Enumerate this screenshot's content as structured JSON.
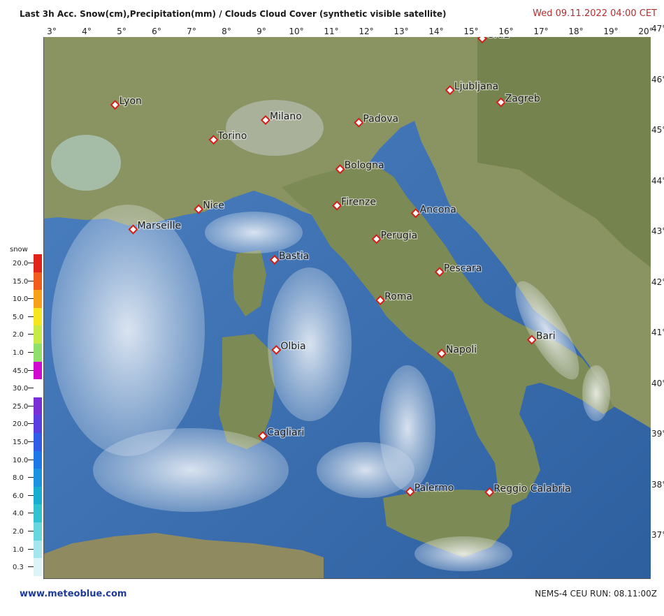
{
  "header": {
    "title": "Last 3h Acc. Snow(cm),Precipitation(mm) / Clouds Cloud Cover (synthetic visible satellite)",
    "datetime": "Wed 09.11.2022  04:00 CET"
  },
  "axes": {
    "longitude_ticks": [
      "3°",
      "4°",
      "5°",
      "6°",
      "7°",
      "8°",
      "9°",
      "10°",
      "11°",
      "12°",
      "13°",
      "14°",
      "15°",
      "16°",
      "17°",
      "18°",
      "19°",
      "20°"
    ],
    "latitude_ticks": [
      "47°",
      "46°",
      "45°",
      "44°",
      "43°",
      "42°",
      "41°",
      "40°",
      "39°",
      "38°",
      "37°"
    ]
  },
  "cities": [
    {
      "name": "Lyon",
      "lon": 4.85,
      "lat": 45.76
    },
    {
      "name": "Milano",
      "lon": 9.19,
      "lat": 45.46
    },
    {
      "name": "Torino",
      "lon": 7.69,
      "lat": 45.07
    },
    {
      "name": "Padova",
      "lon": 11.88,
      "lat": 45.41
    },
    {
      "name": "Ljubljana",
      "lon": 14.51,
      "lat": 46.05
    },
    {
      "name": "Zagreb",
      "lon": 15.98,
      "lat": 45.81
    },
    {
      "name": "Graz",
      "lon": 15.44,
      "lat": 47.07
    },
    {
      "name": "Bologna",
      "lon": 11.34,
      "lat": 44.49
    },
    {
      "name": "Nice",
      "lon": 7.26,
      "lat": 43.7
    },
    {
      "name": "Marseille",
      "lon": 5.37,
      "lat": 43.3
    },
    {
      "name": "Firenze",
      "lon": 11.25,
      "lat": 43.77
    },
    {
      "name": "Ancona",
      "lon": 13.52,
      "lat": 43.62
    },
    {
      "name": "Perugia",
      "lon": 12.39,
      "lat": 43.11
    },
    {
      "name": "Bastia",
      "lon": 9.45,
      "lat": 42.7
    },
    {
      "name": "Pescara",
      "lon": 14.21,
      "lat": 42.46
    },
    {
      "name": "Roma",
      "lon": 12.5,
      "lat": 41.9
    },
    {
      "name": "Bari",
      "lon": 16.87,
      "lat": 41.12
    },
    {
      "name": "Olbia",
      "lon": 9.5,
      "lat": 40.92
    },
    {
      "name": "Napoli",
      "lon": 14.27,
      "lat": 40.85
    },
    {
      "name": "Cagliari",
      "lon": 9.11,
      "lat": 39.22
    },
    {
      "name": "Palermo",
      "lon": 13.36,
      "lat": 38.12
    },
    {
      "name": "Reggio Calabria",
      "lon": 15.65,
      "lat": 38.11
    }
  ],
  "legend": {
    "snow_label": "snow",
    "snow": [
      {
        "value": "20.0",
        "color": "#e2231a"
      },
      {
        "value": "15.0",
        "color": "#f25c1c"
      },
      {
        "value": "10.0",
        "color": "#f7a11b"
      },
      {
        "value": "5.0",
        "color": "#f5e61e"
      },
      {
        "value": "2.0",
        "color": "#c7ea46"
      },
      {
        "value": "1.0",
        "color": "#8ee06a"
      }
    ],
    "precipitation": [
      {
        "value": "45.0",
        "color": "#d10ad0"
      },
      {
        "value": "30.0",
        "color": "#ffffff"
      },
      {
        "value": "25.0",
        "color": "#7a2fd6"
      },
      {
        "value": "20.0",
        "color": "#5a3fe0"
      },
      {
        "value": "15.0",
        "color": "#2f5de6"
      },
      {
        "value": "10.0",
        "color": "#1f78e8"
      },
      {
        "value": "8.0",
        "color": "#1b93e0"
      },
      {
        "value": "6.0",
        "color": "#18aed0"
      },
      {
        "value": "4.0",
        "color": "#2fc3d2"
      },
      {
        "value": "2.0",
        "color": "#67d6df"
      },
      {
        "value": "1.0",
        "color": "#a4e6ec"
      },
      {
        "value": "0.3",
        "color": "#dcf4f6"
      }
    ]
  },
  "footer": {
    "source": "www.meteoblue.com",
    "model_run": "NEMS-4 CEU  RUN: 08.11:00Z"
  },
  "colors": {
    "sea": "#3a6fb0",
    "land": "#7c8a55",
    "cloud": "#f2f4f6",
    "city_marker": "#d0201a"
  }
}
